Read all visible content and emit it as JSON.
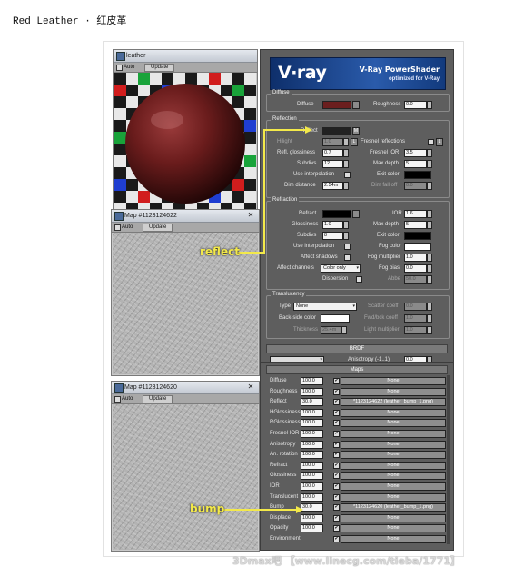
{
  "caption": "Red Leather · 红皮革",
  "material_window": {
    "title": "leather",
    "auto_label": "Auto",
    "update_label": "Update"
  },
  "map_window_1": {
    "title": "Map #1123124622",
    "auto_label": "Auto",
    "update_label": "Update"
  },
  "map_window_2": {
    "title": "Map #1123124620",
    "auto_label": "Auto",
    "update_label": "Update"
  },
  "banner": {
    "logo": "V·ray",
    "title": "V-Ray PowerShader",
    "subtitle": "optimized for V-Ray"
  },
  "diffuse": {
    "group_label": "Diffuse",
    "diffuse_label": "Diffuse",
    "diffuse_color": "#6b1e1e",
    "roughness_label": "Roughness",
    "roughness_value": "0.0"
  },
  "reflection": {
    "group_label": "Reflection",
    "reflect_label": "Reflect",
    "reflect_btn": "M",
    "hilight_label": "Hilight",
    "hilight_value": "1.0",
    "l_btn": "L",
    "fresnel_label": "Fresnel reflections",
    "refl_gloss_label": "Refl. glossiness",
    "refl_gloss_value": "0.7",
    "fresnel_ior_label": "Fresnel IOR",
    "fresnel_ior_value": "3.5",
    "subdivs_label": "Subdivs",
    "subdivs_value": "12",
    "max_depth_label": "Max depth",
    "max_depth_value": "5",
    "use_interp_label": "Use interpolation",
    "exit_color_label": "Exit color",
    "dim_distance_label": "Dim distance",
    "dim_distance_value": "2.54m",
    "dim_falloff_label": "Dim fall off",
    "dim_falloff_value": "0.0"
  },
  "refraction": {
    "group_label": "Refraction",
    "refract_label": "Refract",
    "ior_label": "IOR",
    "ior_value": "1.6",
    "glossiness_label": "Glossiness",
    "glossiness_value": "1.0",
    "max_depth_label": "Max depth",
    "max_depth_value": "5",
    "subdivs_label": "Subdivs",
    "subdivs_value": "8",
    "exit_color_label": "Exit color",
    "use_interp_label": "Use interpolation",
    "fog_color_label": "Fog color",
    "affect_shadows_label": "Affect shadows",
    "fog_multiplier_label": "Fog multiplier",
    "fog_multiplier_value": "1.0",
    "affect_channels_label": "Affect channels",
    "affect_channels_value": "Color only",
    "fog_bias_label": "Fog bias",
    "fog_bias_value": "0.0",
    "dispersion_label": "Dispersion",
    "abbe_label": "Abbe",
    "abbe_value": "50.0"
  },
  "translucency": {
    "group_label": "Translucency",
    "type_label": "Type",
    "type_value": "None",
    "scatter_label": "Scatter coeff",
    "scatter_value": "0.0",
    "backside_label": "Back-side color",
    "fwd_bck_label": "Fwd/bck coeff",
    "fwd_bck_value": "1.0",
    "thickness_label": "Thickness",
    "thickness_value": "25.4m",
    "light_mult_label": "Light multiplier",
    "light_mult_value": "1.0"
  },
  "brdf": {
    "rollout_label": "BRDF",
    "anisotropy_label": "Anisotropy (-1..1)",
    "anisotropy_value": "0.0"
  },
  "maps": {
    "rollout_label": "Maps",
    "rows": [
      {
        "name": "Diffuse",
        "value": "100.0",
        "checked": "✔",
        "map": "None"
      },
      {
        "name": "Roughness",
        "value": "100.0",
        "checked": "✔",
        "map": "None"
      },
      {
        "name": "Reflect",
        "value": "30.0",
        "checked": "✔",
        "map": "*1123124622 (leather_bump_1.png)"
      },
      {
        "name": "HGlossiness",
        "value": "100.0",
        "checked": "✔",
        "map": "None"
      },
      {
        "name": "RGlossiness",
        "value": "100.0",
        "checked": "✔",
        "map": "None"
      },
      {
        "name": "Fresnel IOR",
        "value": "100.0",
        "checked": "✔",
        "map": "None"
      },
      {
        "name": "Anisotropy",
        "value": "100.0",
        "checked": "✔",
        "map": "None"
      },
      {
        "name": "An. rotation",
        "value": "100.0",
        "checked": "✔",
        "map": "None"
      },
      {
        "name": "Refract",
        "value": "100.0",
        "checked": "✔",
        "map": "None"
      },
      {
        "name": "Glossiness",
        "value": "100.0",
        "checked": "✔",
        "map": "None"
      },
      {
        "name": "IOR",
        "value": "100.0",
        "checked": "✔",
        "map": "None"
      },
      {
        "name": "Translucent",
        "value": "100.0",
        "checked": "✔",
        "map": "None"
      },
      {
        "name": "Bump",
        "value": "30.0",
        "checked": "✔",
        "map": "*1123124620 (leather_bump_1.png)"
      },
      {
        "name": "Displace",
        "value": "100.0",
        "checked": "✔",
        "map": "None"
      },
      {
        "name": "Opacity",
        "value": "100.0",
        "checked": "✔",
        "map": "None"
      },
      {
        "name": "Environment",
        "value": "",
        "checked": "✔",
        "map": "None"
      }
    ]
  },
  "annotations": {
    "reflect": "reflect",
    "bump": "bump",
    "color": "#f3e94a"
  },
  "watermark": "3Dmax吧 【www.linecg.com/tieba/1771】"
}
